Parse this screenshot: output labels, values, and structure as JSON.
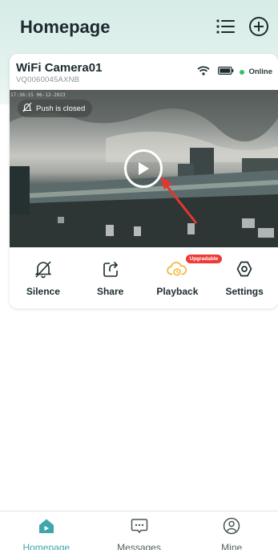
{
  "header": {
    "title": "Homepage",
    "list_icon": "list-icon",
    "add_icon": "plus-circle-icon"
  },
  "device": {
    "name": "WiFi Camera01",
    "id": "VQ0060045AXNB",
    "status": "Online",
    "status_color": "#35c06a",
    "wifi_icon": "wifi-icon",
    "battery_icon": "battery-icon",
    "video": {
      "timestamp": "17:36:15 06-12-2023",
      "push_status": "Push is closed",
      "play_icon": "play-icon"
    }
  },
  "actions": [
    {
      "label": "Silence",
      "icon": "bell-off-icon"
    },
    {
      "label": "Share",
      "icon": "share-icon"
    },
    {
      "label": "Playback",
      "icon": "cloud-playback-icon",
      "badge": "Upgradable"
    },
    {
      "label": "Settings",
      "icon": "settings-hexagon-icon"
    }
  ],
  "nav": [
    {
      "label": "Homepage",
      "icon": "home-icon",
      "active": true
    },
    {
      "label": "Messages",
      "icon": "message-icon",
      "active": false
    },
    {
      "label": "Mine",
      "icon": "user-icon",
      "active": false
    }
  ],
  "colors": {
    "accent": "#3fa6ad",
    "badge": "#ef3b36",
    "playback_icon": "#f2b42c",
    "arrow": "#e3362e"
  }
}
